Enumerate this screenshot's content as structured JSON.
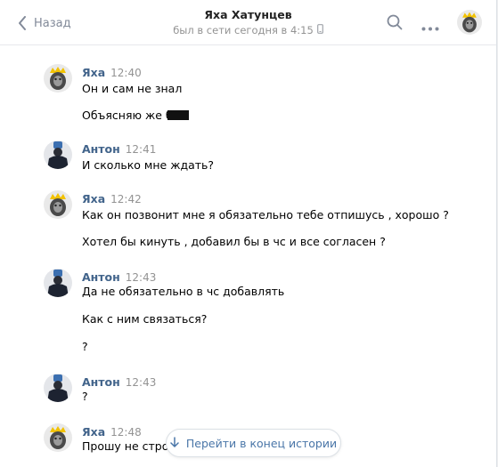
{
  "header": {
    "back_label": "Назад",
    "title": "Яха Хатунцев",
    "subtitle": "был в сети сегодня в 4:15",
    "icons": [
      "back-chevron-icon",
      "search-icon",
      "more-icon",
      "mobile-icon"
    ]
  },
  "colors": {
    "name": "#42648b",
    "link": "#4a76a8",
    "muted": "#939393",
    "background": "#edeef0"
  },
  "messages": [
    {
      "author": "Яха",
      "time": "12:40",
      "lines": [
        "Он и сам не знал",
        "Объясняю же б"
      ]
    },
    {
      "author": "Антон",
      "time": "12:41",
      "lines": [
        "И сколько мне ждать?"
      ]
    },
    {
      "author": "Яха",
      "time": "12:42",
      "lines": [
        "Как он позвонит мне я обязательно тебе отпишусь , хорошо ?",
        "Хотел бы кинуть , добавил бы в чс и все согласен ?"
      ]
    },
    {
      "author": "Антон",
      "time": "12:43",
      "lines": [
        "Да не обязательно в чс добавлять",
        "Как с ним связаться?",
        "?"
      ]
    },
    {
      "author": "Антон",
      "time": "12:43",
      "lines": [
        "?"
      ]
    },
    {
      "author": "Яха",
      "time": "12:48",
      "lines": [
        "Прошу не строч"
      ]
    }
  ],
  "scroll_to_end": {
    "label": "Перейти в конец истории"
  }
}
